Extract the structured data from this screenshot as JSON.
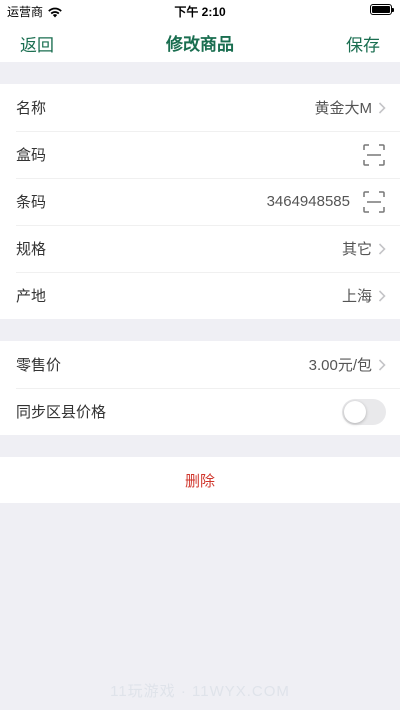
{
  "status": {
    "carrier": "运营商",
    "time": "下午 2:10"
  },
  "nav": {
    "back_label": "返回",
    "title": "修改商品",
    "save_label": "保存"
  },
  "product": {
    "name": {
      "label": "名称",
      "value": "黄金大M"
    },
    "box_code": {
      "label": "盒码",
      "value": ""
    },
    "barcode": {
      "label": "条码",
      "value": "3464948585"
    },
    "spec": {
      "label": "规格",
      "value": "其它"
    },
    "origin": {
      "label": "产地",
      "value": "上海"
    }
  },
  "pricing": {
    "retail_price": {
      "label": "零售价",
      "value": "3.00元/包"
    },
    "sync_county": {
      "label": "同步区县价格",
      "enabled": false
    }
  },
  "actions": {
    "delete_label": "删除"
  },
  "watermark": "11玩游戏 · 11WYX.COM",
  "colors": {
    "accent": "#1a6e50",
    "danger": "#d0362c",
    "background": "#efeff4"
  },
  "icons": [
    "wifi-icon",
    "battery-icon",
    "chevron-right-icon",
    "scan-icon",
    "toggle-switch"
  ]
}
